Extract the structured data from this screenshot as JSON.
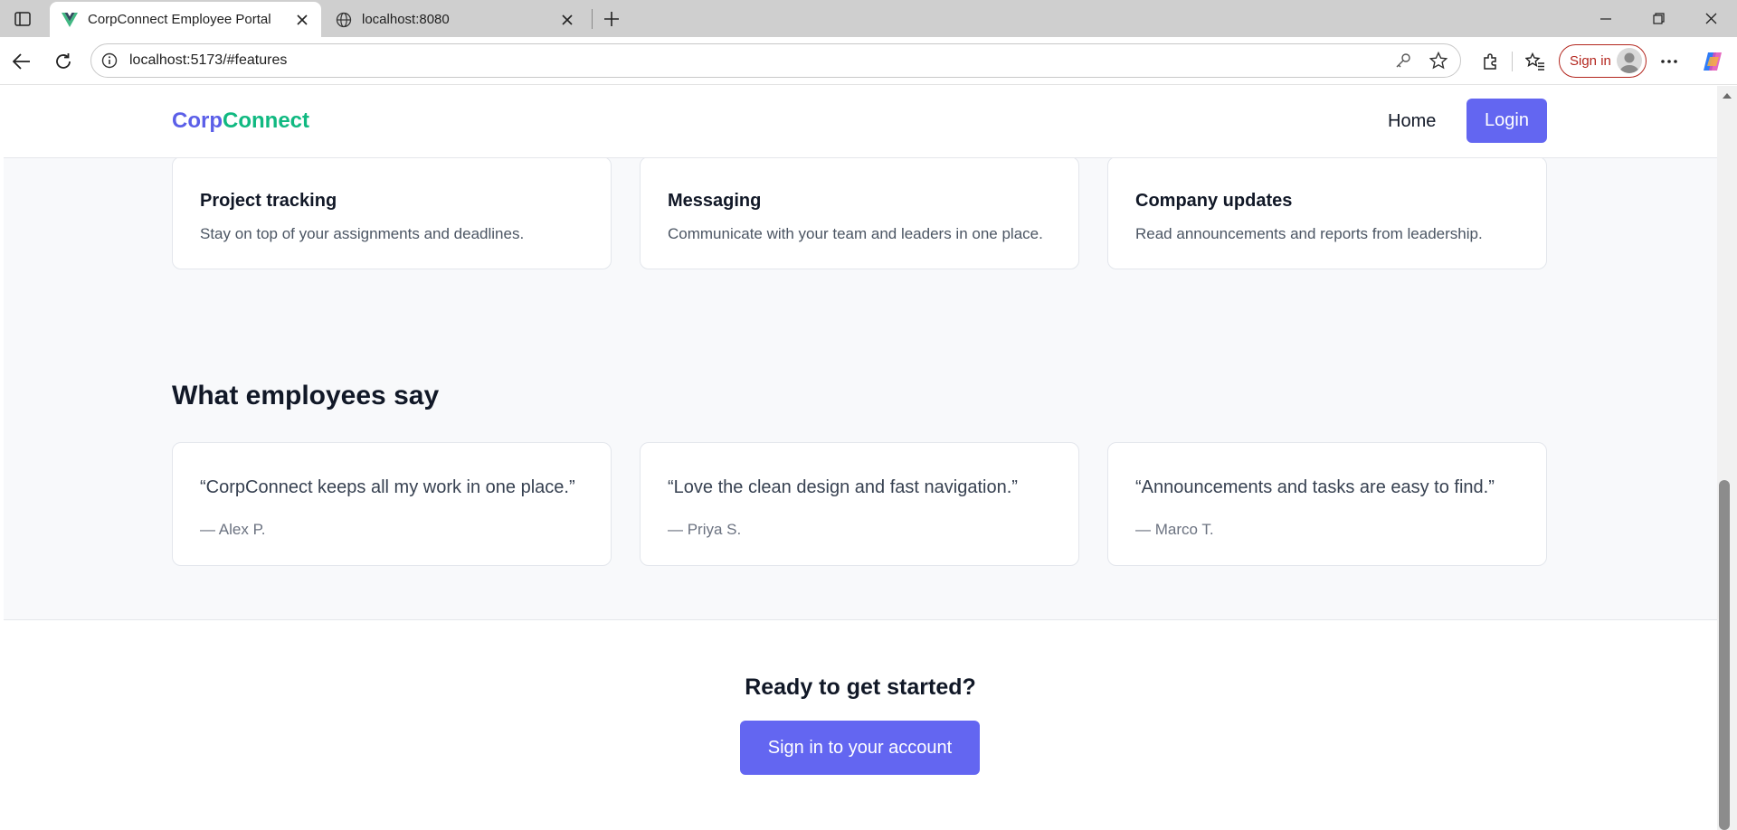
{
  "browser": {
    "tabs": [
      {
        "title": "CorpConnect Employee Portal",
        "active": true,
        "favicon": "vue-logo-icon"
      },
      {
        "title": "localhost:8080",
        "active": false,
        "favicon": "globe-icon"
      }
    ],
    "address": {
      "url": "localhost:5173/#features"
    },
    "profile": {
      "signin_label": "Sign in"
    },
    "colors": {
      "signin_accent": "#b3261e",
      "tabbar": "#cfcfcf"
    }
  },
  "site": {
    "brand": {
      "part1": "Corp",
      "part2": "Connect",
      "color1": "#5b5fe8",
      "color2": "#10b981"
    },
    "nav": {
      "home": "Home",
      "login": "Login"
    },
    "colors": {
      "primary": "#6366f1",
      "background": "#f8f9fb"
    }
  },
  "features": [
    {
      "title": "Project tracking",
      "desc": "Stay on top of your assignments and deadlines."
    },
    {
      "title": "Messaging",
      "desc": "Communicate with your team and leaders in one place."
    },
    {
      "title": "Company updates",
      "desc": "Read announcements and reports from leadership."
    }
  ],
  "testimonials": {
    "title": "What employees say",
    "items": [
      {
        "quote": "“CorpConnect keeps all my work in one place.”",
        "author": "— Alex P."
      },
      {
        "quote": "“Love the clean design and fast navigation.”",
        "author": "— Priya S."
      },
      {
        "quote": "“Announcements and tasks are easy to find.”",
        "author": "— Marco T."
      }
    ]
  },
  "cta": {
    "heading": "Ready to get started?",
    "button": "Sign in to your account"
  }
}
